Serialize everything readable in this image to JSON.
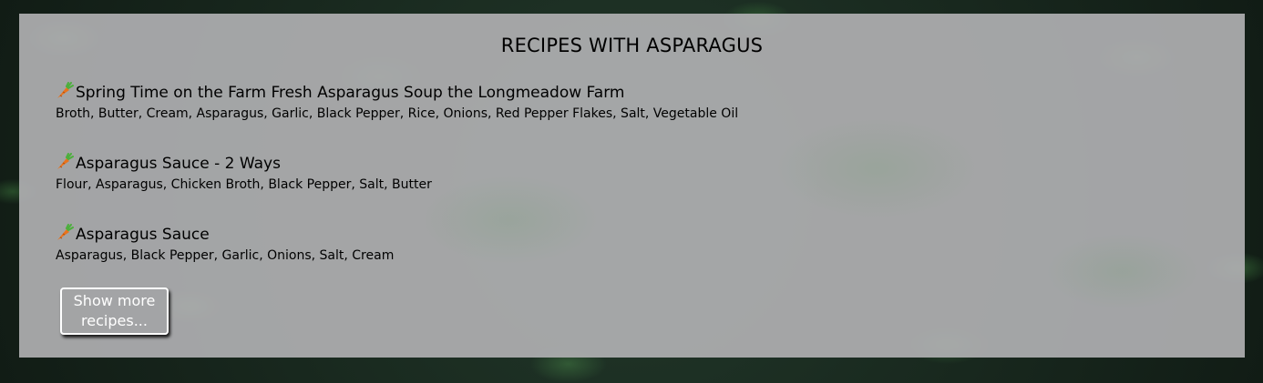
{
  "section": {
    "title": "RECIPES WITH ASPARAGUS"
  },
  "recipes": [
    {
      "icon": "carrot-icon",
      "title": "Spring Time on the Farm Fresh Asparagus Soup the Longmeadow Farm",
      "ingredients": "Broth, Butter, Cream, Asparagus, Garlic, Black Pepper, Rice, Onions, Red Pepper Flakes, Salt, Vegetable Oil"
    },
    {
      "icon": "carrot-icon",
      "title": "Asparagus Sauce - 2 Ways",
      "ingredients": "Flour, Asparagus, Chicken Broth, Black Pepper, Salt, Butter"
    },
    {
      "icon": "carrot-icon",
      "title": "Asparagus Sauce",
      "ingredients": "Asparagus, Black Pepper, Garlic, Onions, Salt, Cream"
    }
  ],
  "show_more": {
    "label": "Show more recipes..."
  },
  "colors": {
    "panel": "#b0b0b2",
    "button_text": "#ffffff",
    "carrot_orange": "#e8731c",
    "carrot_green": "#4caf3c"
  }
}
